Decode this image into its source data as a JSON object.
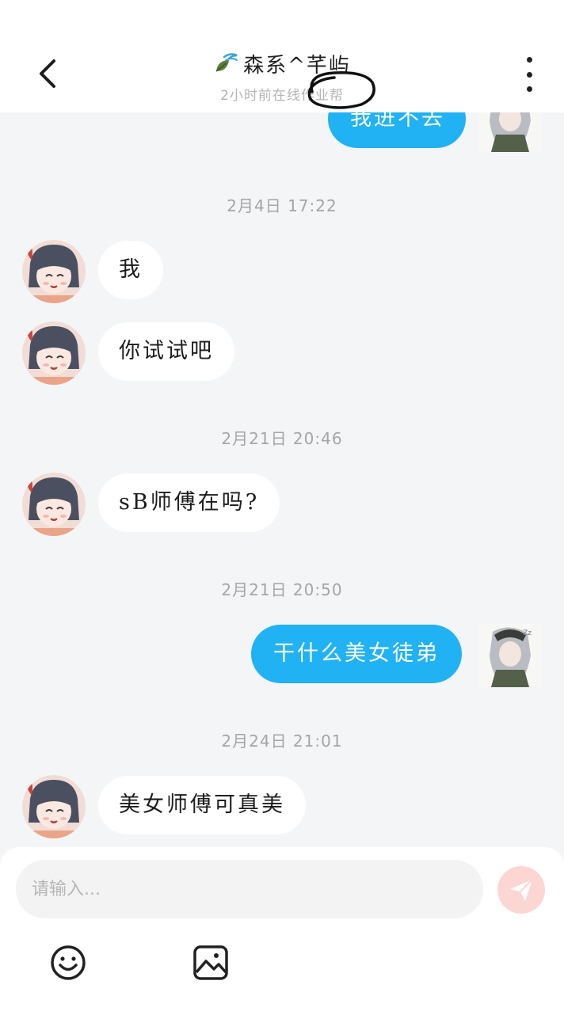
{
  "header": {
    "title": "森系^芊屿",
    "subtitle": "2小时前在线作业帮"
  },
  "messages": [
    {
      "side": "out",
      "text": "我进不去"
    },
    {
      "type": "timestamp",
      "text": "2月4日 17:22"
    },
    {
      "side": "in",
      "text": "我"
    },
    {
      "side": "in",
      "text": "你试试吧"
    },
    {
      "type": "timestamp",
      "text": "2月21日 20:46"
    },
    {
      "side": "in",
      "text": "sB师傅在吗?"
    },
    {
      "type": "timestamp",
      "text": "2月21日 20:50"
    },
    {
      "side": "out",
      "text": "干什么美女徒弟"
    },
    {
      "type": "timestamp",
      "text": "2月24日 21:01"
    },
    {
      "side": "in",
      "text": "美女师傅可真美"
    }
  ],
  "composer": {
    "placeholder": "请输入..."
  },
  "colors": {
    "out_bubble": "#21b2f3",
    "in_bubble": "#ffffff",
    "background": "#f4f5f7",
    "send_button": "#fbd6d2"
  },
  "icons": {
    "back": "chevron-left-icon",
    "more": "more-vertical-icon",
    "send": "paper-plane-icon",
    "emoji": "smiley-icon",
    "image": "image-icon"
  }
}
